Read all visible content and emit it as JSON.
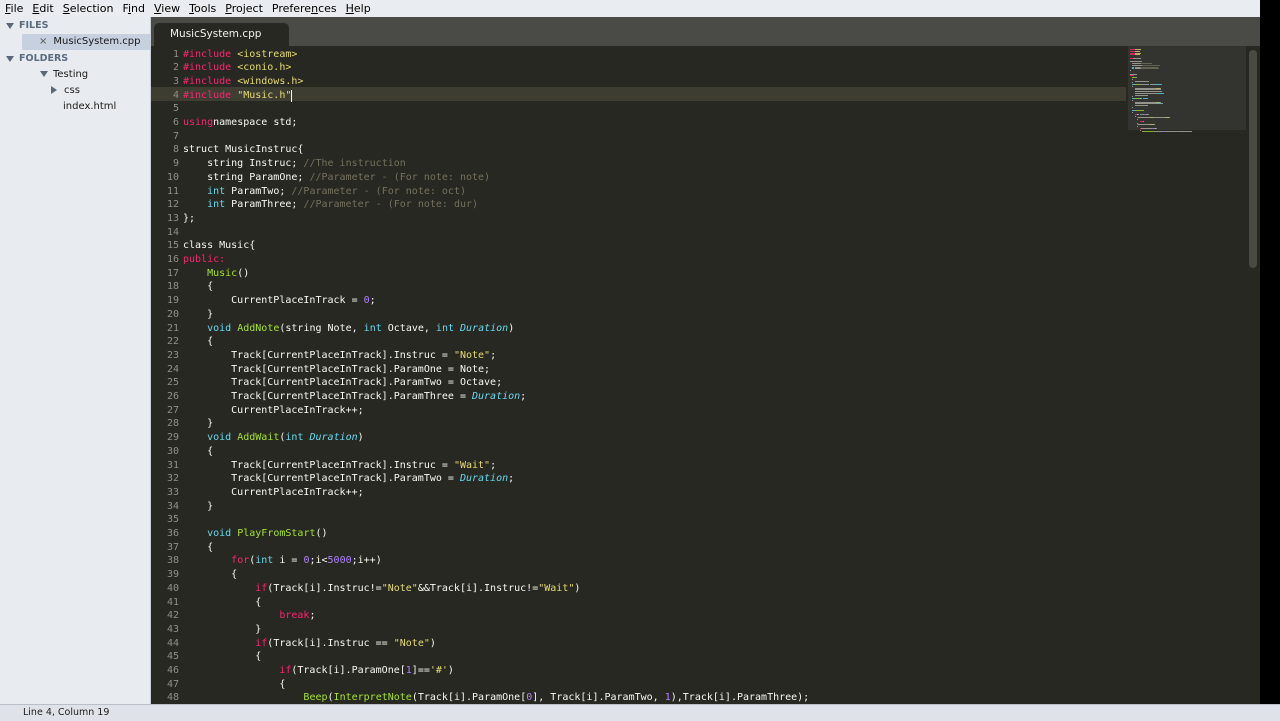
{
  "menu": [
    "File",
    "Edit",
    "Selection",
    "Find",
    "View",
    "Tools",
    "Project",
    "Preferences",
    "Help"
  ],
  "menu_mnemonics": [
    "F",
    "E",
    "S",
    "i",
    "V",
    "T",
    "P",
    "n",
    "H"
  ],
  "sidebar": {
    "files_header": "FILES",
    "open_file": "MusicSystem.cpp",
    "folders_header": "FOLDERS",
    "folder": "Testing",
    "subfolder": "css",
    "file": "index.html"
  },
  "tab": {
    "label": "MusicSystem.cpp"
  },
  "status": {
    "text": "Line 4, Column 19"
  },
  "colors": {
    "editor_bg": "#272822",
    "keyword": "#f92672",
    "type": "#66d9ef",
    "string": "#e6db74",
    "comment": "#75715e",
    "function": "#a6e22e",
    "number": "#ae81ff",
    "param": "#fd971f"
  },
  "code": [
    [
      [
        "kw",
        "#include "
      ],
      [
        "st",
        "<iostream>"
      ]
    ],
    [
      [
        "kw",
        "#include "
      ],
      [
        "st",
        "<conio.h>"
      ]
    ],
    [
      [
        "kw",
        "#include "
      ],
      [
        "st",
        "<windows.h>"
      ]
    ],
    [
      [
        "kw",
        "#include "
      ],
      [
        "st",
        "\"Music.h\""
      ]
    ],
    [],
    [
      [
        "kw",
        "using"
      ],
      [
        "",
        "namespace std;"
      ]
    ],
    [],
    [
      [
        "",
        "struct MusicInstruc{"
      ]
    ],
    [
      [
        "",
        "    string Instruc; "
      ],
      [
        "cm",
        "//The instruction"
      ]
    ],
    [
      [
        "",
        "    string ParamOne; "
      ],
      [
        "cm",
        "//Parameter - (For note: note)"
      ]
    ],
    [
      [
        "",
        "    "
      ],
      [
        "ty",
        "int"
      ],
      [
        "",
        " ParamTwo; "
      ],
      [
        "cm",
        "//Parameter - (For note: oct)"
      ]
    ],
    [
      [
        "",
        "    "
      ],
      [
        "ty",
        "int"
      ],
      [
        "",
        " ParamThree; "
      ],
      [
        "cm",
        "//Parameter - (For note: dur)"
      ]
    ],
    [
      [
        "",
        "};"
      ]
    ],
    [],
    [
      [
        "",
        "class Music{"
      ]
    ],
    [
      [
        "kw",
        "public:"
      ]
    ],
    [
      [
        "",
        "    "
      ],
      [
        "fn",
        "Music"
      ],
      [
        "",
        "()"
      ]
    ],
    [
      [
        "",
        "    {"
      ]
    ],
    [
      [
        "",
        "        CurrentPlaceInTrack = "
      ],
      [
        "nu",
        "0"
      ],
      [
        "",
        ";"
      ]
    ],
    [
      [
        "",
        "    }"
      ]
    ],
    [
      [
        "",
        "    "
      ],
      [
        "ty",
        "void"
      ],
      [
        "",
        " "
      ],
      [
        "fn",
        "AddNote"
      ],
      [
        "",
        "(string Note, "
      ],
      [
        "ty",
        "int"
      ],
      [
        "",
        " Octave, "
      ],
      [
        "ty",
        "int"
      ],
      [
        "",
        " "
      ],
      [
        "it",
        "Duration"
      ],
      [
        "",
        ")"
      ]
    ],
    [
      [
        "",
        "    {"
      ]
    ],
    [
      [
        "",
        "        Track[CurrentPlaceInTrack].Instruc = "
      ],
      [
        "st",
        "\"Note\""
      ],
      [
        "",
        ";"
      ]
    ],
    [
      [
        "",
        "        Track[CurrentPlaceInTrack].ParamOne = Note;"
      ]
    ],
    [
      [
        "",
        "        Track[CurrentPlaceInTrack].ParamTwo = Octave;"
      ]
    ],
    [
      [
        "",
        "        Track[CurrentPlaceInTrack].ParamThree = "
      ],
      [
        "it",
        "Duration"
      ],
      [
        "",
        ";"
      ]
    ],
    [
      [
        "",
        "        CurrentPlaceInTrack++;"
      ]
    ],
    [
      [
        "",
        "    }"
      ]
    ],
    [
      [
        "",
        "    "
      ],
      [
        "ty",
        "void"
      ],
      [
        "",
        " "
      ],
      [
        "fn",
        "AddWait"
      ],
      [
        "",
        "("
      ],
      [
        "ty",
        "int"
      ],
      [
        "",
        " "
      ],
      [
        "it",
        "Duration"
      ],
      [
        "",
        ")"
      ]
    ],
    [
      [
        "",
        "    {"
      ]
    ],
    [
      [
        "",
        "        Track[CurrentPlaceInTrack].Instruc = "
      ],
      [
        "st",
        "\"Wait\""
      ],
      [
        "",
        ";"
      ]
    ],
    [
      [
        "",
        "        Track[CurrentPlaceInTrack].ParamTwo = "
      ],
      [
        "it",
        "Duration"
      ],
      [
        "",
        ";"
      ]
    ],
    [
      [
        "",
        "        CurrentPlaceInTrack++;"
      ]
    ],
    [
      [
        "",
        "    }"
      ]
    ],
    [],
    [
      [
        "",
        "    "
      ],
      [
        "ty",
        "void"
      ],
      [
        "",
        " "
      ],
      [
        "fn",
        "PlayFromStart"
      ],
      [
        "",
        "()"
      ]
    ],
    [
      [
        "",
        "    {"
      ]
    ],
    [
      [
        "",
        "        "
      ],
      [
        "kw",
        "for"
      ],
      [
        "",
        "("
      ],
      [
        "ty",
        "int"
      ],
      [
        "",
        " i = "
      ],
      [
        "nu",
        "0"
      ],
      [
        "",
        ";i<"
      ],
      [
        "nu",
        "5000"
      ],
      [
        "",
        ";i++)"
      ]
    ],
    [
      [
        "",
        "        {"
      ]
    ],
    [
      [
        "",
        "            "
      ],
      [
        "kw",
        "if"
      ],
      [
        "",
        "(Track[i].Instruc!="
      ],
      [
        "st",
        "\"Note\""
      ],
      [
        "",
        "&&Track[i].Instruc!="
      ],
      [
        "st",
        "\"Wait\""
      ],
      [
        "",
        ")"
      ]
    ],
    [
      [
        "",
        "            {"
      ]
    ],
    [
      [
        "",
        "                "
      ],
      [
        "kw",
        "break"
      ],
      [
        "",
        ";"
      ]
    ],
    [
      [
        "",
        "            }"
      ]
    ],
    [
      [
        "",
        "            "
      ],
      [
        "kw",
        "if"
      ],
      [
        "",
        "(Track[i].Instruc == "
      ],
      [
        "st",
        "\"Note\""
      ],
      [
        "",
        ")"
      ]
    ],
    [
      [
        "",
        "            {"
      ]
    ],
    [
      [
        "",
        "                "
      ],
      [
        "kw",
        "if"
      ],
      [
        "",
        "(Track[i].ParamOne["
      ],
      [
        "nu",
        "1"
      ],
      [
        "",
        "]=="
      ],
      [
        "st",
        "'#'"
      ],
      [
        "",
        ")"
      ]
    ],
    [
      [
        "",
        "                {"
      ]
    ],
    [
      [
        "",
        "                    "
      ],
      [
        "fn",
        "Beep"
      ],
      [
        "",
        "("
      ],
      [
        "fn",
        "InterpretNote"
      ],
      [
        "",
        "(Track[i].ParamOne["
      ],
      [
        "nu",
        "0"
      ],
      [
        "",
        "], Track[i].ParamTwo, "
      ],
      [
        "nu",
        "1"
      ],
      [
        "",
        "),Track[i].ParamThree);"
      ]
    ]
  ]
}
